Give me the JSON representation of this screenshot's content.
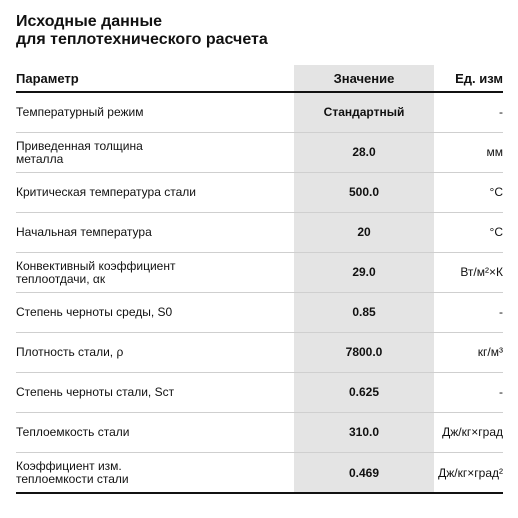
{
  "title": {
    "line1": "Исходные данные",
    "line2": "для теплотехнического расчета"
  },
  "table": {
    "headers": {
      "param": "Параметр",
      "value": "Значение",
      "unit": "Ед. изм"
    },
    "rows": [
      {
        "param": "Температурный режим",
        "value": "Стандартный",
        "unit": "-"
      },
      {
        "param": "Приведенная толщина\nметалла",
        "value": "28.0",
        "unit": "мм"
      },
      {
        "param": "Критическая температура стали",
        "value": "500.0",
        "unit": "°C"
      },
      {
        "param": "Начальная температура",
        "value": "20",
        "unit": "°C"
      },
      {
        "param": "Конвективный коэффициент\nтеплоотдачи, αк",
        "value": "29.0",
        "unit": "Вт/м²×К"
      },
      {
        "param": "Степень черноты среды, S0",
        "value": "0.85",
        "unit": "-"
      },
      {
        "param": "Плотность стали, ρ",
        "value": "7800.0",
        "unit": "кг/м³"
      },
      {
        "param": "Степень черноты стали, Sст",
        "value": "0.625",
        "unit": "-"
      },
      {
        "param": "Теплоемкость стали",
        "value": "310.0",
        "unit": "Дж/кг×град"
      },
      {
        "param": "Коэффициент изм.\nтеплоемкости стали",
        "value": "0.469",
        "unit": "Дж/кг×град²"
      }
    ]
  },
  "colors": {
    "value_column_background": "#e4e4e4",
    "text": "#111111",
    "row_divider": "#cfcfcf"
  }
}
